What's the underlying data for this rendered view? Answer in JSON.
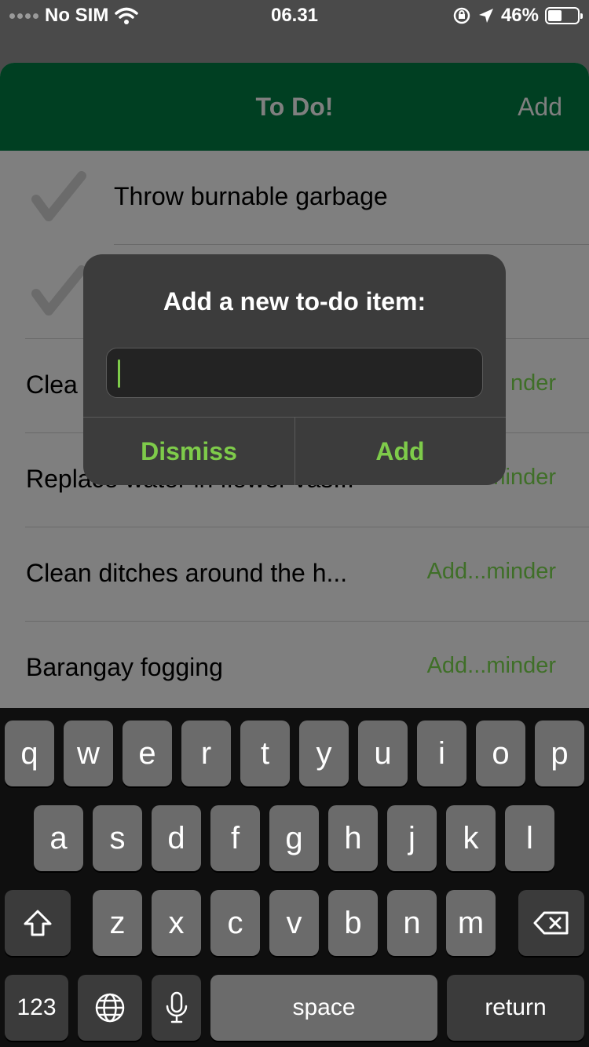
{
  "status": {
    "carrier": "No SIM",
    "time": "06.31",
    "battery": "46%",
    "battery_level": 0.46
  },
  "nav": {
    "title": "To Do!",
    "add": "Add"
  },
  "list": [
    {
      "text": "Throw burnable garbage",
      "checked": true,
      "action": ""
    },
    {
      "text": "",
      "checked": true,
      "action": ""
    },
    {
      "text": "Clea",
      "checked": false,
      "action": "nder"
    },
    {
      "text": "Replace water in flower vas...",
      "checked": false,
      "action": "Add...minder"
    },
    {
      "text": "Clean ditches around the h...",
      "checked": false,
      "action": "Add...minder"
    },
    {
      "text": "Barangay fogging",
      "checked": false,
      "action": "Add...minder"
    }
  ],
  "alert": {
    "title": "Add a new to-do item:",
    "input_value": "",
    "dismiss": "Dismiss",
    "add": "Add"
  },
  "keyboard": {
    "row1": [
      "q",
      "w",
      "e",
      "r",
      "t",
      "y",
      "u",
      "i",
      "o",
      "p"
    ],
    "row2": [
      "a",
      "s",
      "d",
      "f",
      "g",
      "h",
      "j",
      "k",
      "l"
    ],
    "row3": [
      "z",
      "x",
      "c",
      "v",
      "b",
      "n",
      "m"
    ],
    "numbers": "123",
    "space": "space",
    "return": "return"
  },
  "colors": {
    "nav_bg": "#003f22",
    "accent": "#7ecb4a",
    "list_action": "#3f6f28"
  }
}
